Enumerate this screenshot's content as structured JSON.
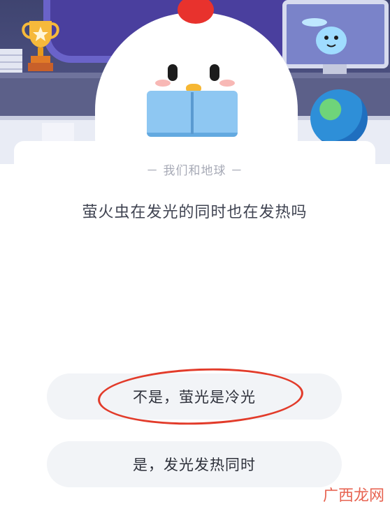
{
  "quiz": {
    "category": "－ 我们和地球 －",
    "question": "萤火虫在发光的同时也在发热吗",
    "options": [
      "不是，萤光是冷光",
      "是，发光发热同时"
    ]
  },
  "watermark": "广西龙网",
  "colors": {
    "annotation_circle": "#e23b2a",
    "option_background": "#f2f4f7",
    "header_background": "#4b4f7e"
  }
}
